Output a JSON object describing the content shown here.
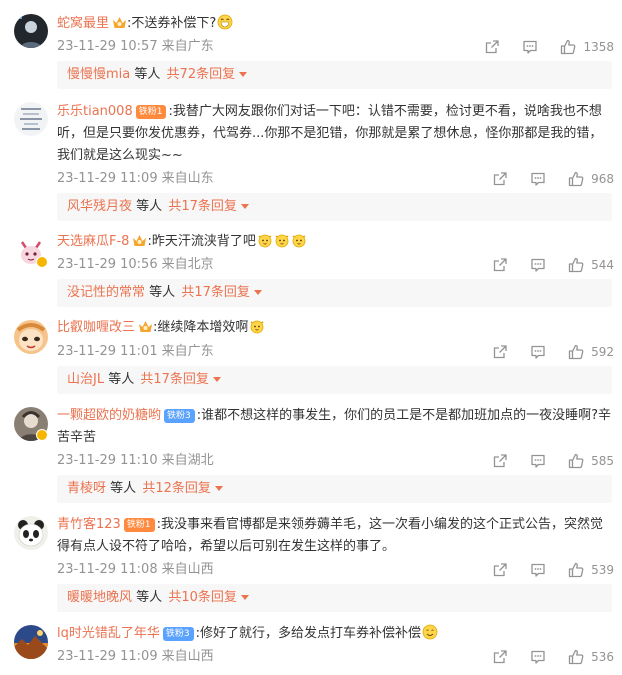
{
  "comments": [
    {
      "username": "蛇窝最里",
      "text": ":不送券补偿下?",
      "time": "23-11-29 10:57",
      "location": "来自广东",
      "likes": "1358",
      "reply_user": "慢慢慢mia",
      "reply_suffix": "等人",
      "reply_total": "共72条回复",
      "emoji": [
        "grin-emoji"
      ]
    },
    {
      "username": "乐乐tian008",
      "badge": "铁粉1",
      "text": ":我替广大网友跟你们对话一下吧：认错不需要，检讨更不看，说啥我也不想听，但是只要你发优惠券，代驾券...你那不是犯错，你那就是累了想休息，怪你那都是我的错，我们就是这么现实~~",
      "time": "23-11-29 11:09",
      "location": "来自山东",
      "likes": "968",
      "reply_user": "风华残月夜",
      "reply_suffix": "等人",
      "reply_total": "共17条回复"
    },
    {
      "username": "天选麻瓜F-8",
      "text": ":昨天汗流浃背了吧",
      "time": "23-11-29 10:56",
      "location": "来自北京",
      "likes": "544",
      "reply_user": "没记性的常常",
      "reply_suffix": "等人",
      "reply_total": "共17条回复",
      "emoji": [
        "cat-emoji",
        "cat-emoji",
        "cat-emoji"
      ]
    },
    {
      "username": "比叡咖喱改三",
      "text": ":继续降本增效啊",
      "time": "23-11-29 11:01",
      "location": "来自广东",
      "likes": "592",
      "reply_user": "山治JL",
      "reply_suffix": "等人",
      "reply_total": "共17条回复",
      "emoji": [
        "cat-emoji"
      ]
    },
    {
      "username": "一颗超欧的奶糖哟",
      "badge": "铁粉3",
      "text": ":谁都不想这样的事发生，你们的员工是不是都加班加点的一夜没睡啊?辛苦辛苦",
      "time": "23-11-29 11:10",
      "location": "来自湖北",
      "likes": "585",
      "reply_user": "青棱呀",
      "reply_suffix": "等人",
      "reply_total": "共12条回复"
    },
    {
      "username": "青竹客123",
      "badge": "铁粉1",
      "text": ":我没事来看官博都是来领券薅羊毛，这一次看小编发的这个正式公告，突然觉得有点人设不符了哈哈，希望以后可别在发生这样的事了。",
      "time": "23-11-29 11:08",
      "location": "来自山西",
      "likes": "539",
      "reply_user": "暖暖地晚风",
      "reply_suffix": "等人",
      "reply_total": "共10条回复"
    },
    {
      "username": "lq时光错乱了年华",
      "badge": "铁粉3",
      "text": ":修好了就行，多给发点打车券补偿补偿",
      "time": "23-11-29 11:09",
      "location": "来自山西",
      "likes": "536",
      "emoji": [
        "smile-emoji"
      ]
    }
  ],
  "colors": {
    "accent": "#eb7350",
    "meta": "#939393",
    "reply_bg": "#f7f7f7",
    "fan_badge": "#ff8a3d",
    "blue_badge": "#5aa2ff"
  }
}
